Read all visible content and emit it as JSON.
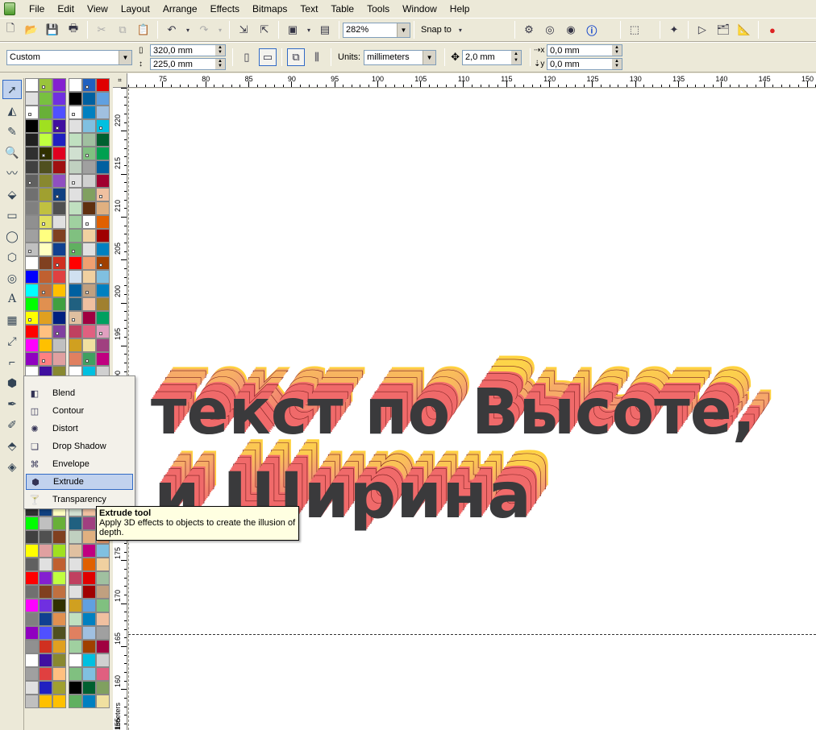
{
  "menu": [
    "File",
    "Edit",
    "View",
    "Layout",
    "Arrange",
    "Effects",
    "Bitmaps",
    "Text",
    "Table",
    "Tools",
    "Window",
    "Help"
  ],
  "toolbar": {
    "zoom": "282%",
    "snap_to": "Snap to"
  },
  "property_bar": {
    "paper_type": "Custom",
    "width": "320,0 mm",
    "height": "225,0 mm",
    "units_label": "Units:",
    "units": "millimeters",
    "nudge": "2,0 mm",
    "dup_x": "0,0 mm",
    "dup_y": "0,0 mm"
  },
  "ruler_top": [
    "75",
    "80",
    "85",
    "90",
    "95",
    "100",
    "105",
    "110",
    "115",
    "120",
    "125",
    "130",
    "135",
    "140",
    "145",
    "150"
  ],
  "ruler_left": [
    "220",
    "215",
    "210",
    "205",
    "200",
    "195",
    "190",
    "175",
    "170",
    "165",
    "160",
    "155",
    "millimeters"
  ],
  "canvas": {
    "line1": "текст по Высоте,",
    "line2": "и Ширина"
  },
  "flyout": {
    "items": [
      {
        "label": "Blend",
        "icon": "blend-icon"
      },
      {
        "label": "Contour",
        "icon": "contour-icon"
      },
      {
        "label": "Distort",
        "icon": "distort-icon"
      },
      {
        "label": "Drop Shadow",
        "icon": "drop-shadow-icon"
      },
      {
        "label": "Envelope",
        "icon": "envelope-icon"
      },
      {
        "label": "Extrude",
        "icon": "extrude-icon"
      },
      {
        "label": "Transparency",
        "icon": "transparency-icon"
      }
    ],
    "selected": "Extrude"
  },
  "tooltip": {
    "title": "Extrude tool",
    "description": "Apply 3D effects to objects to create the illusion of depth."
  },
  "colors": {
    "selection": "#c1d2ee",
    "text_front": "#3a3a3c",
    "extrude_start": "#f05a6a",
    "extrude_end": "#ffe040"
  }
}
